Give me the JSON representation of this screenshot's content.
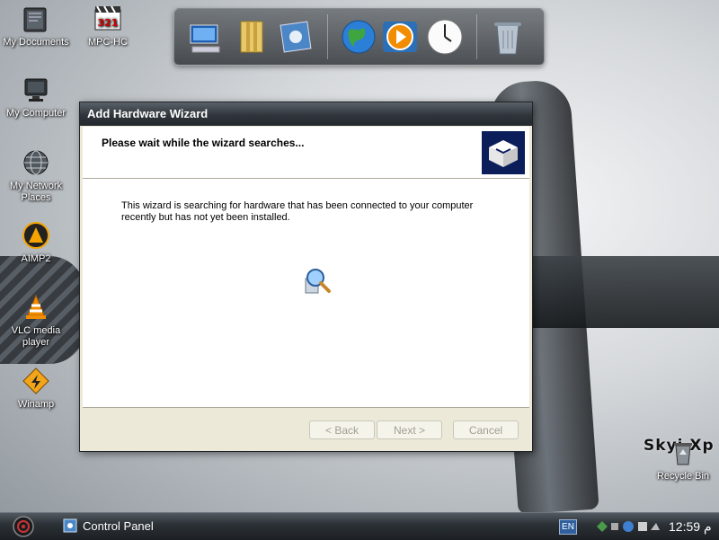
{
  "desktop": {
    "icons": [
      {
        "label": "My Documents",
        "icon": "folder-documents-icon"
      },
      {
        "label": "MPC-HC",
        "icon": "media-player-classic-icon"
      },
      {
        "label": "My Computer",
        "icon": "computer-monitor-icon"
      },
      {
        "label": "My Network Places",
        "icon": "network-globe-icon"
      },
      {
        "label": "AIMP2",
        "icon": "aimp-icon"
      },
      {
        "label": "VLC media player",
        "icon": "vlc-cone-icon"
      },
      {
        "label": "Winamp",
        "icon": "winamp-icon"
      },
      {
        "label": "Recycle Bin",
        "icon": "recycle-bin-icon"
      }
    ],
    "brand_text": "Skyi  Xp"
  },
  "dock": {
    "items": [
      "computer-icon",
      "folder-icon",
      "control-panel-icon",
      "globe-icon",
      "media-player-icon",
      "clock-icon",
      "trash-icon"
    ]
  },
  "wizard": {
    "title": "Add Hardware Wizard",
    "heading": "Please wait while the wizard searches...",
    "description": "This wizard is searching for hardware that has been connected to your computer recently but has not yet been installed.",
    "buttons": {
      "back": "< Back",
      "next": "Next >",
      "cancel": "Cancel"
    }
  },
  "taskbar": {
    "task_label": "Control Panel",
    "language": "EN",
    "clock": "12:59 م"
  },
  "colors": {
    "titlebar": "#2f353b",
    "taskbar": "#2c3237",
    "window_face": "#ece9d8"
  }
}
